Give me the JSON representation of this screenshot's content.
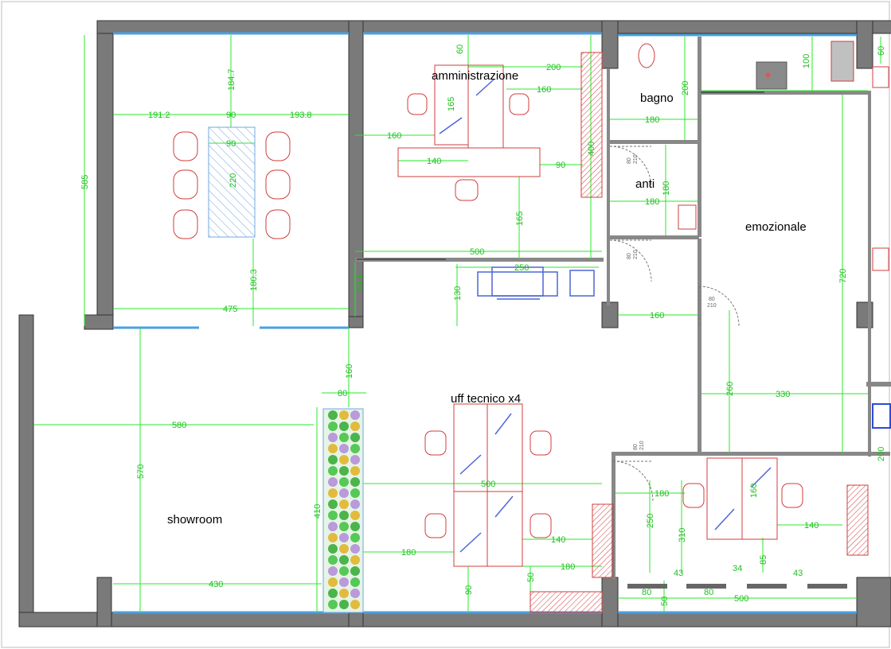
{
  "rooms": {
    "amministrazione": "amministrazione",
    "bagno": "bagno",
    "anti": "anti",
    "emozionale": "emozionale",
    "uff_tecnico": "uff tecnico x4",
    "showroom": "showroom"
  },
  "dimensions": {
    "d_60a": "60",
    "d_200a": "200",
    "d_160a": "160",
    "d_165a": "165",
    "d_160b": "160",
    "d_140a": "140",
    "d_90a": "90",
    "d_165b": "165",
    "d_400": "400",
    "d_500a": "500",
    "d_250a": "250",
    "d_130": "130",
    "d_184_7": "184.7",
    "d_191_2": "191.2",
    "d_90b": "90",
    "d_193_8": "193.8",
    "d_90c": "90",
    "d_220": "220",
    "d_180_3": "180.3",
    "d_475": "475",
    "d_80_1": "80.1",
    "d_585": "585",
    "d_200b": "200",
    "d_180a": "180",
    "d_180b": "180",
    "d_180c": "180",
    "d_160c": "160",
    "d_100": "100",
    "d_60b": "60",
    "d_720": "720",
    "d_260": "260",
    "d_330": "330",
    "d_200c": "200",
    "d_160d": "160",
    "d_80a": "80",
    "d_580": "580",
    "d_570": "570",
    "d_410": "410",
    "d_430": "430",
    "d_500b": "500",
    "d_180d": "180",
    "d_140b": "140",
    "d_180e": "180",
    "d_90d": "90",
    "d_50a": "50",
    "d_180f": "180",
    "d_250b": "250",
    "d_310": "310",
    "d_160e": "160",
    "d_140c": "140",
    "d_85": "85",
    "d_43a": "43",
    "d_34": "34",
    "d_43b": "43",
    "d_80b": "80",
    "d_80c": "80",
    "d_50b": "50",
    "d_500c": "500"
  },
  "door_tags": {
    "t1a": "80",
    "t1b": "210",
    "t2a": "80",
    "t2b": "210",
    "t3a": "80",
    "t3b": "210",
    "t4a": "80",
    "t4b": "210"
  },
  "colors": {
    "wall": "#7a7a7a",
    "dimension": "#29e829",
    "furniture": "#d23c3c",
    "monitor": "#4b66d6",
    "window": "#4aa0e0"
  }
}
